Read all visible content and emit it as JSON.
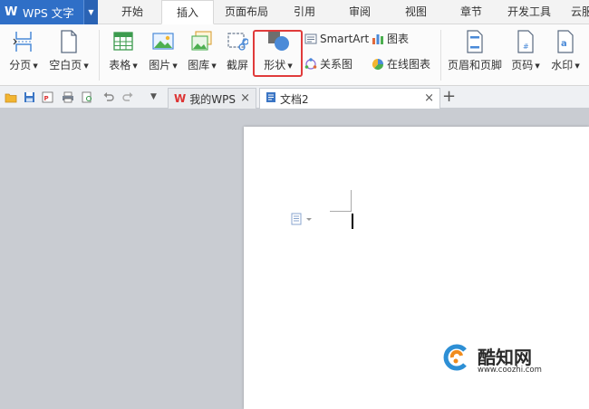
{
  "app": {
    "name": "WPS 文字"
  },
  "menu_tabs": [
    "开始",
    "插入",
    "页面布局",
    "引用",
    "审阅",
    "视图",
    "章节",
    "开发工具",
    "云服"
  ],
  "active_menu_tab": "插入",
  "ribbon": {
    "page_break": "分页",
    "blank_page": "空白页",
    "table": "表格",
    "picture": "图片",
    "gallery": "图库",
    "screenshot": "截屏",
    "shape": "形状",
    "smartart": "SmartArt",
    "chart": "图表",
    "relation_diagram": "关系图",
    "online_chart": "在线图表",
    "header_footer": "页眉和页脚",
    "page_number": "页码",
    "watermark": "水印"
  },
  "doc_tabs": [
    {
      "label": "我的WPS",
      "active": false
    },
    {
      "label": "文档2",
      "active": true
    }
  ],
  "add_tab_symbol": "+",
  "watermark_brand": {
    "name": "酷知网",
    "url": "www.coozhi.com"
  },
  "colors": {
    "accent_blue": "#2f6fc7",
    "highlight_red": "#e03b3b",
    "workspace_gray": "#c9ccd2"
  }
}
